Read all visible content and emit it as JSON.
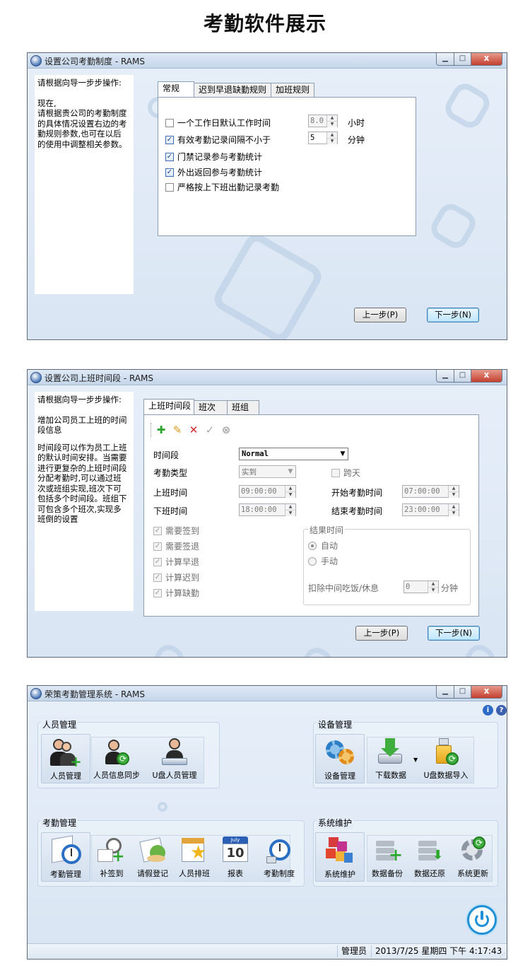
{
  "page_title": "考勤软件展示",
  "window1": {
    "title": "设置公司考勤制度 - RAMS",
    "info": {
      "guide": "请根据向导一步步操作:",
      "text_lines": [
        "现在,",
        "请根据贵公司的考勤制度",
        "的具体情况设置右边的考",
        "勤规则参数,也可在以后",
        "的使用中调整相关参数。"
      ]
    },
    "tabs": [
      "常规",
      "迟到早退缺勤规则",
      "加班规则"
    ],
    "options": [
      {
        "label": "一个工作日默认工作时间",
        "checked": false
      },
      {
        "label": "有效考勤记录间隔不小于",
        "checked": true
      },
      {
        "label": "门禁记录参与考勤统计",
        "checked": true
      },
      {
        "label": "外出返回参与考勤统计",
        "checked": true
      },
      {
        "label": "严格按上下班出勤记录考勤",
        "checked": false
      }
    ],
    "work_hours": {
      "value": "8.0",
      "unit": "小时"
    },
    "interval": {
      "value": "5",
      "unit": "分钟"
    },
    "prev_button": "上一步(P)",
    "next_button": "下一步(N)"
  },
  "window2": {
    "title": "设置公司上班时间段 - RAMS",
    "info": {
      "guide": "请根据向导一步步操作:",
      "p1_lines": [
        "增加公司员工上班的时间",
        "段信息"
      ],
      "p2_lines": [
        "时间段可以作为员工上班",
        "的默认时间安排。当需要",
        "进行更复杂的上班时间段",
        "分配考勤时,可以通过班",
        "次或班组实现,班次下可",
        "包括多个时间段。班组下",
        "可包含多个班次,实现多",
        "班倒的设置"
      ]
    },
    "tabs": [
      "上班时间段",
      "班次",
      "班组"
    ],
    "toolbar_icons": [
      "add-icon",
      "edit-icon",
      "delete-icon",
      "confirm-icon",
      "cancel-icon"
    ],
    "form": {
      "period_label": "时间段",
      "period_value": "Normal",
      "type_label": "考勤类型",
      "type_value": "实到",
      "cross_day_label": "跨天",
      "start_label": "上班时间",
      "start_value": "09:00:00",
      "end_label": "下班时间",
      "end_value": "18:00:00",
      "att_start_label": "开始考勤时间",
      "att_start_value": "07:00:00",
      "att_end_label": "结束考勤时间",
      "att_end_value": "23:00:00"
    },
    "checks": [
      "需要签到",
      "需要签退",
      "计算早退",
      "计算迟到",
      "计算缺勤"
    ],
    "result_group": {
      "title": "结果时间",
      "auto": "自动",
      "manual": "手动",
      "deduct_label": "扣除中间吃饭/休息",
      "deduct_value": "0",
      "deduct_unit": "分钟"
    },
    "prev_button": "上一步(P)",
    "next_button": "下一步(N)"
  },
  "window3": {
    "title": "荣策考勤管理系统 - RAMS",
    "groups": {
      "personnel": {
        "name": "人员管理",
        "items": [
          "人员管理",
          "人员信息同步",
          "U盘人员管理"
        ]
      },
      "device": {
        "name": "设备管理",
        "items": [
          "设备管理",
          "下载数据",
          "U盘数据导入"
        ]
      },
      "attendance": {
        "name": "考勤管理",
        "items": [
          "考勤管理",
          "补签到",
          "请假登记",
          "人员排班",
          "报表",
          "考勤制度"
        ]
      },
      "system": {
        "name": "系统维护",
        "items": [
          "系统维护",
          "数据备份",
          "数据还原",
          "系统更新"
        ]
      }
    },
    "calendar_month": "July",
    "calendar_day": "10",
    "status": {
      "user": "管理员",
      "datetime": "2013/7/25 星期四 下午 4:17:43"
    }
  }
}
